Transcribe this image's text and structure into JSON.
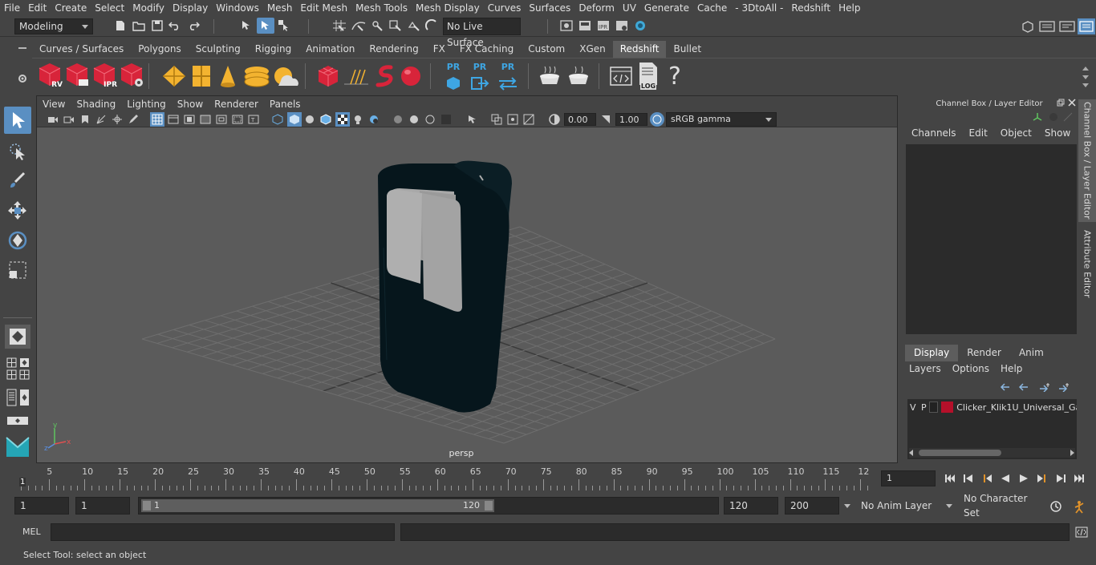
{
  "menus": [
    "File",
    "Edit",
    "Create",
    "Select",
    "Modify",
    "Display",
    "Windows",
    "Mesh",
    "Edit Mesh",
    "Mesh Tools",
    "Mesh Display",
    "Curves",
    "Surfaces",
    "Deform",
    "UV",
    "Generate",
    "Cache",
    "- 3DtoAll -",
    "Redshift",
    "Help"
  ],
  "status": {
    "workspace": "Modeling",
    "live_surface": "No Live Surface"
  },
  "shelf_tabs": [
    "Curves / Surfaces",
    "Polygons",
    "Sculpting",
    "Rigging",
    "Animation",
    "Rendering",
    "FX",
    "FX Caching",
    "Custom",
    "XGen",
    "Redshift",
    "Bullet"
  ],
  "active_shelf_tab": "Redshift",
  "shelf_labels": {
    "rv": "RV",
    "ipr": "IPR",
    "pr1": "PR",
    "pr2": "PR",
    "pr3": "PR",
    "log": "LOG",
    "help": "?"
  },
  "viewport": {
    "menus": [
      "View",
      "Shading",
      "Lighting",
      "Show",
      "Renderer",
      "Panels"
    ],
    "exposure": "0.00",
    "gamma": "1.00",
    "colorspace": "sRGB gamma",
    "camera_label": "persp",
    "axis_y": "y",
    "axis_x": "x",
    "axis_z": "z"
  },
  "channel_box": {
    "title": "Channel Box / Layer Editor",
    "menus": [
      "Channels",
      "Edit",
      "Object",
      "Show"
    ]
  },
  "layer_editor": {
    "tabs": [
      "Display",
      "Render",
      "Anim"
    ],
    "active_tab": "Display",
    "menus": [
      "Layers",
      "Options",
      "Help"
    ],
    "layer": {
      "v": "V",
      "p": "P",
      "name": "Clicker_Klik1U_Universal_Ga",
      "color": "#b5102a"
    }
  },
  "side_tabs": [
    "Channel Box / Layer Editor",
    "Attribute Editor"
  ],
  "timeline": {
    "ticks": [
      "5",
      "10",
      "15",
      "20",
      "25",
      "30",
      "35",
      "40",
      "45",
      "50",
      "55",
      "60",
      "65",
      "70",
      "75",
      "80",
      "85",
      "90",
      "95",
      "100",
      "105",
      "110",
      "115",
      "12"
    ],
    "start_marker": "1",
    "current_frame": "1"
  },
  "range": {
    "start": "1",
    "playback_start": "1",
    "slider_start": "1",
    "slider_end": "120",
    "playback_end": "120",
    "end": "200",
    "anim_layer": "No Anim Layer",
    "character_set": "No Character Set"
  },
  "mel": {
    "label": "MEL"
  },
  "help_line": "Select Tool: select an object",
  "colors": {
    "accent": "#5a8fc2",
    "active_tab": "#5d5d5d",
    "redshift_red": "#d8243a",
    "gold": "#f3b330"
  }
}
